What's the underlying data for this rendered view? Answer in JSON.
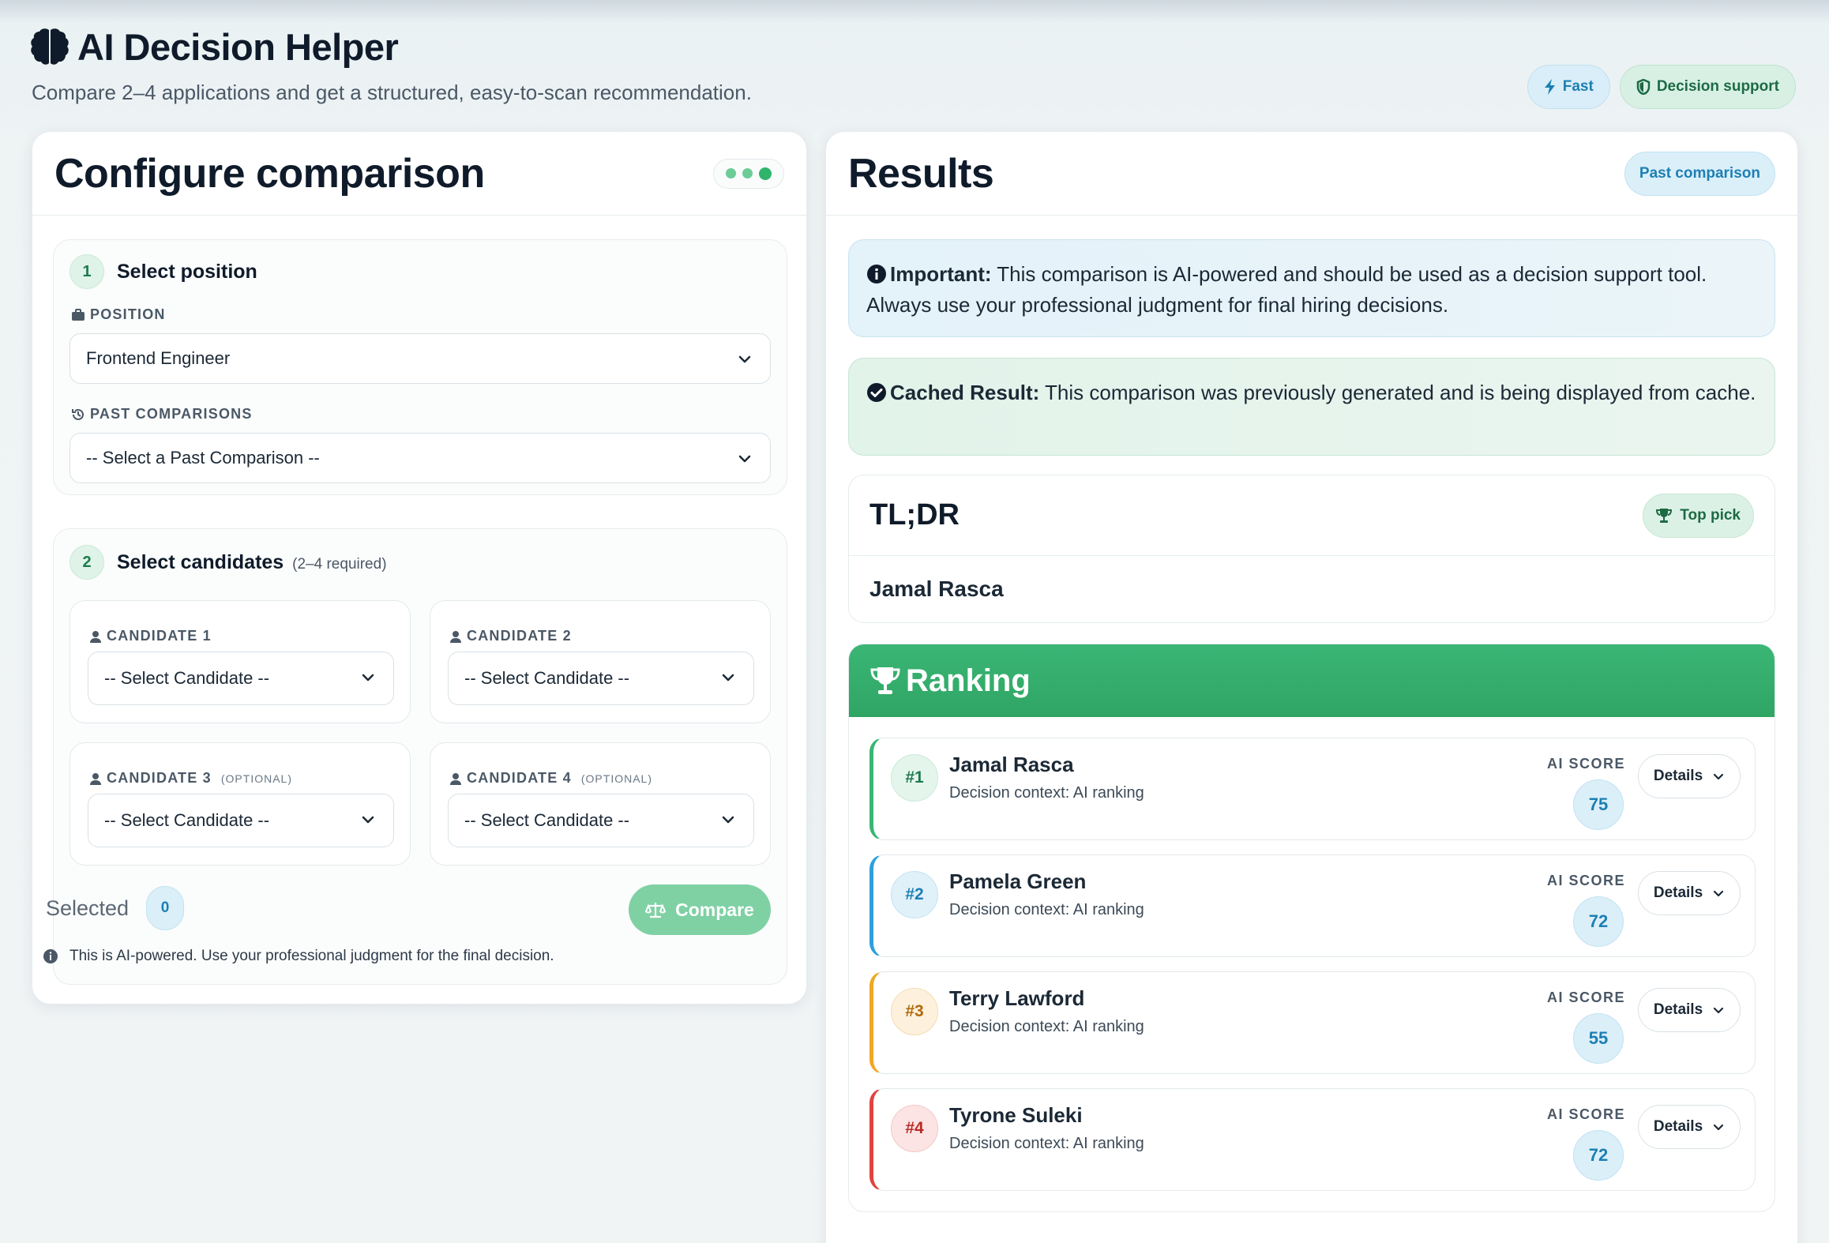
{
  "header": {
    "title": "AI Decision Helper",
    "subtitle": "Compare 2–4 applications and get a structured, easy-to-scan recommendation.",
    "badges": [
      {
        "label": "Fast",
        "icon": "bolt-icon"
      },
      {
        "label": "Decision support",
        "icon": "shield-icon"
      }
    ]
  },
  "config": {
    "title": "Configure comparison",
    "step1": {
      "num": "1",
      "title": "Select position",
      "position_label": "POSITION",
      "position_value": "Frontend Engineer",
      "past_label": "PAST COMPARISONS",
      "past_value": "-- Select a Past Comparison --"
    },
    "step2": {
      "num": "2",
      "title": "Select candidates",
      "note": "(2–4 required)",
      "candidates": [
        {
          "label": "CANDIDATE 1",
          "optional": "",
          "value": "-- Select Candidate --"
        },
        {
          "label": "CANDIDATE 2",
          "optional": "",
          "value": "-- Select Candidate --"
        },
        {
          "label": "CANDIDATE 3",
          "optional": "(OPTIONAL)",
          "value": "-- Select Candidate --"
        },
        {
          "label": "CANDIDATE 4",
          "optional": "(OPTIONAL)",
          "value": "-- Select Candidate --"
        }
      ],
      "selected_label": "Selected",
      "selected_count": "0",
      "compare_label": "Compare",
      "disclaimer": "This is AI-powered. Use your professional judgment for the final decision."
    }
  },
  "results": {
    "title": "Results",
    "badge": "Past comparison",
    "important_label": "Important:",
    "important_text": " This comparison is AI-powered and should be used as a decision support tool. Always use your professional judgment for final hiring decisions.",
    "cached_label": "Cached Result:",
    "cached_text": " This comparison was previously generated and is being displayed from cache.",
    "tldr": {
      "title": "TL;DR",
      "badge": "Top pick",
      "name": "Jamal Rasca"
    },
    "ranking": {
      "title": "Ranking",
      "score_label": "AI SCORE",
      "details_label": "Details",
      "items": [
        {
          "rank": "#1",
          "name": "Jamal Rasca",
          "context": "Decision context: AI ranking",
          "score": "75",
          "color": "#3bb675"
        },
        {
          "rank": "#2",
          "name": "Pamela Green",
          "context": "Decision context: AI ranking",
          "score": "72",
          "color": "#2f9fde"
        },
        {
          "rank": "#3",
          "name": "Terry Lawford",
          "context": "Decision context: AI ranking",
          "score": "55",
          "color": "#f0a825"
        },
        {
          "rank": "#4",
          "name": "Tyrone Suleki",
          "context": "Decision context: AI ranking",
          "score": "72",
          "color": "#e0443e"
        }
      ]
    }
  }
}
